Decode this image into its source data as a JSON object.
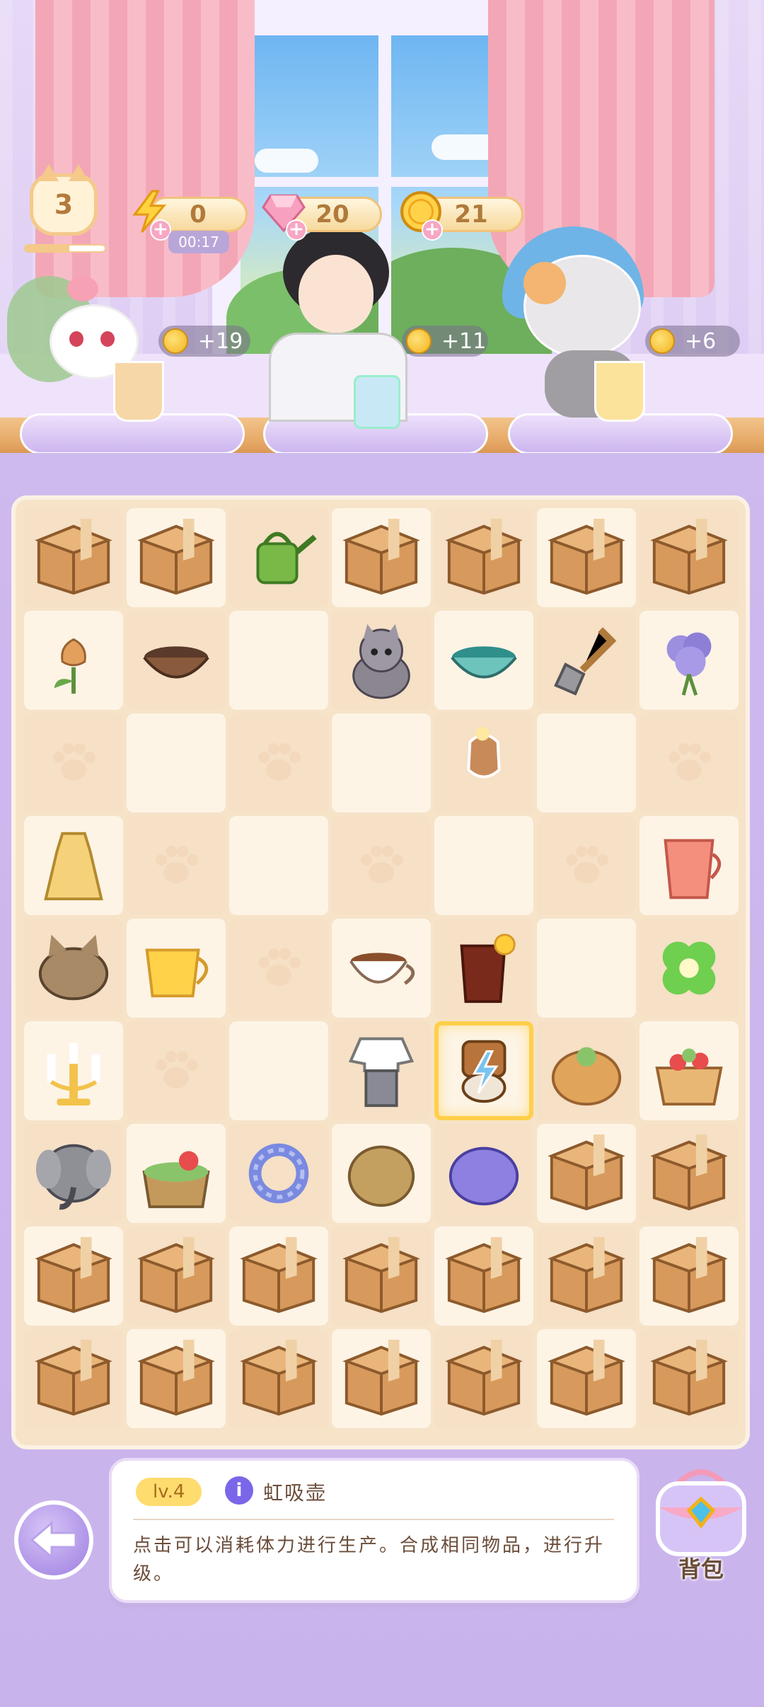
{
  "hud": {
    "level": "3",
    "level_progress": 0.55,
    "energy": "0",
    "energy_timer": "00:17",
    "gems": "20",
    "coins": "21"
  },
  "customers": [
    {
      "name": "white-cat",
      "reward": "+19"
    },
    {
      "name": "boy",
      "reward": "+11"
    },
    {
      "name": "calico-cat",
      "reward": "+6"
    }
  ],
  "board": {
    "rows": [
      [
        "box",
        "box",
        "watering-can",
        "box",
        "box",
        "box",
        "box"
      ],
      [
        "tulip",
        "bowl",
        "empty",
        "cat",
        "teal-bowl",
        "shovel",
        "lavender"
      ],
      [
        "paw",
        "empty",
        "paw",
        "empty",
        "hand",
        "empty",
        "paw"
      ],
      [
        "dress",
        "paw",
        "empty",
        "paw",
        "empty",
        "paw",
        "strawberry-drink"
      ],
      [
        "cat-hat",
        "tea-cup",
        "paw",
        "coffee",
        "cola",
        "empty",
        "clover"
      ],
      [
        "candelabra",
        "paw",
        "empty",
        "blouse",
        "siphon-pot",
        "bun",
        "fruit-cake"
      ],
      [
        "elephant",
        "cake",
        "scrunchie",
        "bread",
        "purple-bun",
        "box",
        "box"
      ],
      [
        "box",
        "box",
        "box",
        "box",
        "box",
        "box",
        "box"
      ],
      [
        "box",
        "box",
        "box",
        "box",
        "box",
        "box",
        "box"
      ]
    ],
    "selected": "siphon-pot"
  },
  "info_panel": {
    "level_label": "lv.4",
    "info_icon": "i",
    "item_name": "虹吸壶",
    "description": "点击可以消耗体力进行生产。合成相同物品，进行升级。"
  },
  "bag": {
    "label": "背包"
  },
  "colors": {
    "accent": "#ffcf4a",
    "panel_border": "#e9dcf7",
    "board": "#f6e3c8"
  }
}
